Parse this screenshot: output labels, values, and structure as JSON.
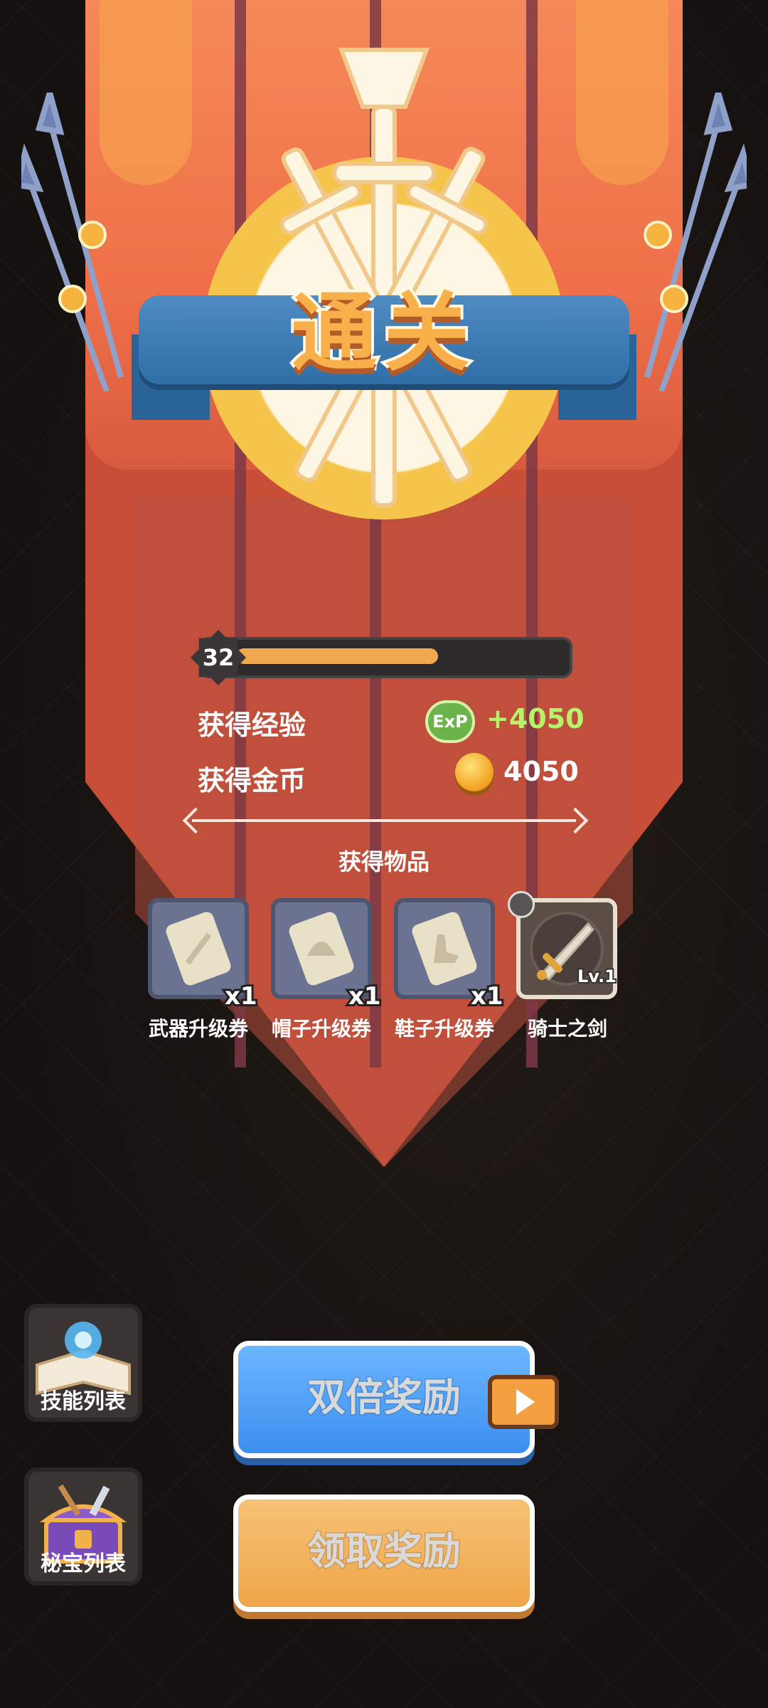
{
  "title": "通关",
  "level": {
    "value": "32",
    "progress": 0.63
  },
  "rewards": {
    "exp_label": "获得经验",
    "exp_icon_text": "ExP",
    "exp_value": "+4050",
    "gold_label": "获得金币",
    "gold_value": "4050"
  },
  "items_title": "获得物品",
  "items": [
    {
      "name": "武器升级券",
      "qty": "x1",
      "icon": "weapon-ticket-icon"
    },
    {
      "name": "帽子升级券",
      "qty": "x1",
      "icon": "hat-ticket-icon"
    },
    {
      "name": "鞋子升级券",
      "qty": "x1",
      "icon": "shoe-ticket-icon"
    },
    {
      "name": "骑士之剑",
      "level": "Lv.1",
      "icon": "knight-sword-icon"
    }
  ],
  "side": {
    "skills_label": "技能列表",
    "treasure_label": "秘宝列表"
  },
  "buttons": {
    "double_reward": "双倍奖励",
    "claim_reward": "领取奖励"
  },
  "colors": {
    "exp_value": "#b6f36a",
    "gold_value": "#ffffff",
    "title": "#f8b14a",
    "blue_button": "#4a9cf6",
    "orange_button": "#f0aa4e"
  }
}
